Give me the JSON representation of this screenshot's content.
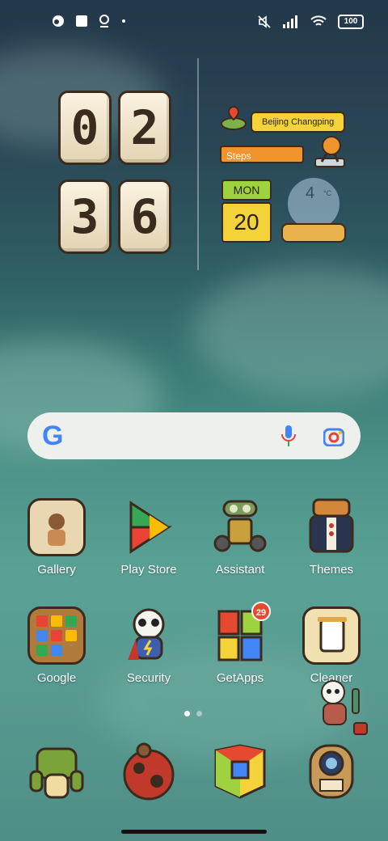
{
  "status_bar": {
    "left_icons": [
      "tiktok-icon",
      "square-icon",
      "location-pin-icon",
      "dot-icon"
    ],
    "right_icons": [
      "mute-icon",
      "signal-icon",
      "wifi-icon"
    ],
    "battery": "100"
  },
  "clock": {
    "hour": [
      "0",
      "2"
    ],
    "minute": [
      "3",
      "6"
    ]
  },
  "widget": {
    "location": "Beijing Changping",
    "steps_label": "Steps",
    "weekday": "MON",
    "date": "20",
    "temperature": "4",
    "temperature_unit": "°C"
  },
  "search": {
    "logo": "G",
    "icons": [
      "microphone-icon",
      "lens-icon"
    ]
  },
  "apps_row1": [
    {
      "label": "Gallery",
      "name": "gallery"
    },
    {
      "label": "Play Store",
      "name": "play-store"
    },
    {
      "label": "Assistant",
      "name": "assistant"
    },
    {
      "label": "Themes",
      "name": "themes"
    }
  ],
  "apps_row2": [
    {
      "label": "Google",
      "name": "google"
    },
    {
      "label": "Security",
      "name": "security"
    },
    {
      "label": "GetApps",
      "name": "getapps",
      "badge": "29"
    },
    {
      "label": "Cleaner",
      "name": "cleaner"
    }
  ],
  "dock": [
    {
      "name": "phone"
    },
    {
      "name": "messages"
    },
    {
      "name": "chrome"
    },
    {
      "name": "camera"
    }
  ],
  "colors": {
    "outline": "#3b2b1f",
    "accent_yellow": "#f4d33a",
    "accent_orange": "#f0952d",
    "accent_green": "#9ed33f",
    "badge": "#e5492f"
  },
  "page_indicator": {
    "pages": 2,
    "current": 1
  }
}
